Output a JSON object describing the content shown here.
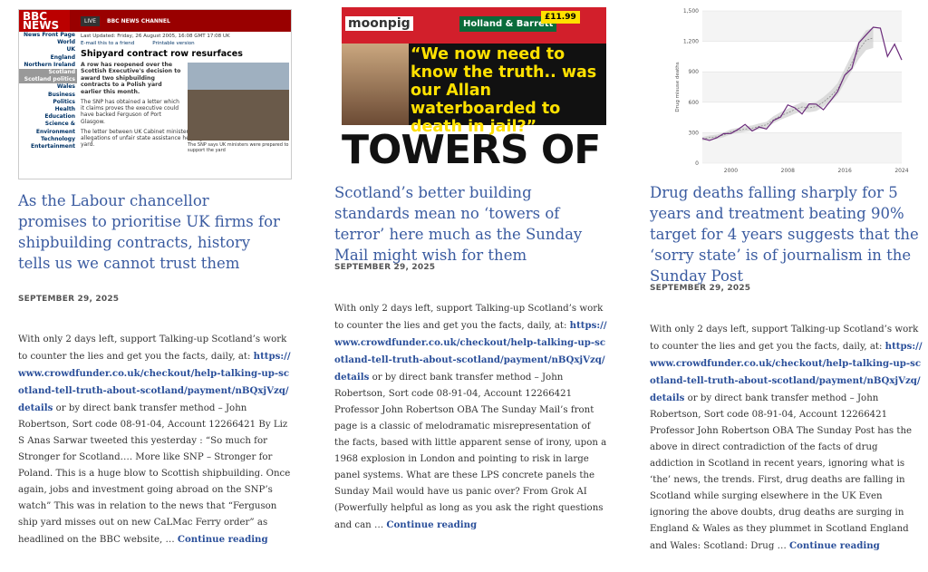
{
  "posts": [
    {
      "title": "As the Labour chancellor promises to prioritise UK firms for shipbuilding contracts, history tells us we cannot trust them",
      "date": "SEPTEMBER 29, 2025",
      "intro": "With only 2 days left, support Talking-up Scotland’s work to counter the lies and get you the facts, daily, at: ",
      "link": "https://www.crowdfunder.co.uk/checkout/help-talking-up-scotland-tell-truth-about-scotland/payment/nBQxjVzq/details",
      "body": " or by direct bank transfer method – John Robertson, Sort code 08-91-04, Account 12266421 By Liz S Anas Sarwar tweeted this yesterday : “So much for Stronger for Scotland…. More like SNP – Stronger for Poland. This is a huge blow to Scottish shipbuilding. Once again, jobs and investment going abroad on the SNP’s watch” This was in relation to the news that “Ferguson ship yard misses out on new CaLMac Ferry order” as headlined on the BBC website, … ",
      "more": "Continue reading"
    },
    {
      "title": "Scotland’s better building standards mean no ‘towers of terror’ here much as the Sunday Mail might wish for them",
      "date": "SEPTEMBER 29, 2025",
      "intro": "With only 2 days left, support Talking-up Scotland’s work to counter the lies and get you the facts, daily, at: ",
      "link": "https://www.crowdfunder.co.uk/checkout/help-talking-up-scotland-tell-truth-about-scotland/payment/nBQxjVzq/details",
      "body": " or by direct bank transfer method – John Robertson, Sort code 08-91-04, Account 12266421 Professor John Robertson OBA The Sunday Mail’s front page is a classic of melodramatic misrepresentation of the facts, based with little apparent sense of irony, upon a 1968 explosion in London and pointing to risk in large panel systems. What are these LPS concrete panels the Sunday Mail would have us panic over? From Grok AI (Powerfully helpful as long as you ask the right questions and can … ",
      "more": "Continue reading"
    },
    {
      "title": "Drug deaths falling sharply for 5 years and treatment beating 90% target for 4 years suggests that the ‘sorry state’ is of journalism in the Sunday Post",
      "date": "SEPTEMBER 29, 2025",
      "intro": "With only 2 days left, support Talking-up Scotland’s work to counter the lies and get you the facts, daily, at: ",
      "link": "https://www.crowdfunder.co.uk/checkout/help-talking-up-scotland-tell-truth-about-scotland/payment/nBQxjVzq/details",
      "body": " or by direct bank transfer method – John Robertson, Sort code 08-91-04, Account 12266421 Professor John Robertson OBA The Sunday Post has the above in direct contradiction of the facts of drug addiction in Scotland in recent years, ignoring what is ‘the’ news, the trends. First, drug deaths are falling in Scotland while surging elsewhere in the UK Even ignoring the above doubts, drug deaths are surging in England & Wales as they plummet in Scotland England and Wales: Scotland: Drug … ",
      "more": "Continue reading"
    }
  ],
  "bbc": {
    "logo": "BBC NEWS",
    "live": "LIVE",
    "channel": "BBC NEWS CHANNEL",
    "nav": [
      "News Front Page",
      "World",
      "UK",
      "England",
      "Northern Ireland",
      "Scotland",
      "Scotland politics",
      "Wales",
      "Business",
      "Politics",
      "Health",
      "Education",
      "Science & Environment",
      "Technology",
      "Entertainment"
    ],
    "updated": "Last Updated: Friday, 26 August 2005, 16:08 GMT 17:08 UK",
    "email": "E-mail this to a friend",
    "print": "Printable version",
    "headline": "Shipyard contract row resurfaces",
    "lead": "A row has reopened over the Scottish Executive's decision to award two shipbuilding contracts to a Polish yard earlier this month.",
    "p1": "The SNP has obtained a letter which it claims proves the executive could have backed Ferguson of Port Glasgow.",
    "p2": "The letter between UK Cabinet ministers expressed concern at allegations of unfair state assistance helping the Polish Remontowa yard.",
    "caption": "The SNP says UK ministers were prepared to support the yard"
  },
  "mail": {
    "moonpig": "moonpig",
    "holland": "Holland & Barrett",
    "price": "£11.99",
    "quote": "“We now need to know the truth.. was our Allan waterboarded to death in jail?”",
    "towers": "TOWERS OF"
  },
  "chart_data": {
    "type": "line",
    "ylabel": "Drug misuse deaths",
    "ylim": [
      0,
      1500
    ],
    "yticks": [
      0,
      300,
      600,
      900,
      1200,
      1500
    ],
    "x": [
      1996,
      1997,
      1998,
      1999,
      2000,
      2001,
      2002,
      2003,
      2004,
      2005,
      2006,
      2007,
      2008,
      2009,
      2010,
      2011,
      2012,
      2013,
      2014,
      2015,
      2016,
      2017,
      2018,
      2019,
      2020,
      2021,
      2022,
      2023,
      2024
    ],
    "series": [
      {
        "values": [
          244,
          224,
          249,
          291,
          292,
          332,
          382,
          317,
          356,
          336,
          421,
          455,
          574,
          545,
          485,
          584,
          581,
          526,
          614,
          706,
          867,
          934,
          1187,
          1264,
          1339,
          1330,
          1051,
          1172,
          1017
        ]
      }
    ],
    "xticks": [
      2000,
      2008,
      2016,
      2024
    ],
    "grid": true
  }
}
